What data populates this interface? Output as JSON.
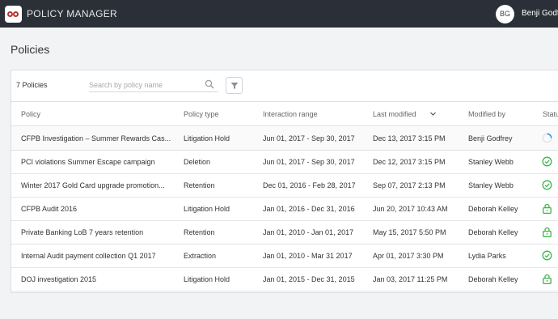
{
  "header": {
    "app_title": "POLICY MANAGER",
    "avatar_initials": "BG",
    "user_name": "Benji Godfrey"
  },
  "page": {
    "title": "Policies"
  },
  "toolbar": {
    "count_label": "7 Policies",
    "search_placeholder": "Search by policy name"
  },
  "table": {
    "columns": {
      "policy": "Policy",
      "policy_type": "Policy type",
      "interaction_range": "Interaction range",
      "last_modified": "Last modified",
      "modified_by": "Modified by",
      "status": "Status"
    },
    "sort": {
      "column": "last_modified",
      "direction": "descending"
    },
    "rows": [
      {
        "policy": "CFPB Investigation – Summer Rewards Cas...",
        "type": "Litigation Hold",
        "range": "Jun 01, 2017 - Sep 30, 2017",
        "last_modified": "Dec 13, 2017 3:15 PM",
        "modified_by": "Benji Godfrey",
        "status_icon": "loading-spinner-icon"
      },
      {
        "policy": "PCI violations Summer Escape campaign",
        "type": "Deletion",
        "range": "Jun 01, 2017 - Sep 30, 2017",
        "last_modified": "Dec 12, 2017 3:15 PM",
        "modified_by": "Stanley Webb",
        "status_icon": "check-circle-icon"
      },
      {
        "policy": "Winter 2017 Gold Card upgrade promotion...",
        "type": "Retention",
        "range": "Dec 01, 2016 - Feb 28, 2017",
        "last_modified": "Sep 07, 2017 2:13 PM",
        "modified_by": "Stanley Webb",
        "status_icon": "check-circle-icon"
      },
      {
        "policy": "CFPB Audit 2016",
        "type": "Litigation Hold",
        "range": "Jan 01, 2016 - Dec 31, 2016",
        "last_modified": "Jun 20, 2017 10:43 AM",
        "modified_by": "Deborah Kelley",
        "status_icon": "lock-icon"
      },
      {
        "policy": "Private Banking LoB 7 years retention",
        "type": "Retention",
        "range": "Jan 01, 2010 - Jan 01, 2017",
        "last_modified": "May 15, 2017 5:50 PM",
        "modified_by": "Deborah Kelley",
        "status_icon": "lock-icon"
      },
      {
        "policy": "Internal Audit payment collection Q1 2017",
        "type": "Extraction",
        "range": "Jan 01, 2010 - Mar 31 2017",
        "last_modified": "Apr 01, 2017 3:30 PM",
        "modified_by": "Lydia Parks",
        "status_icon": "check-circle-icon"
      },
      {
        "policy": "DOJ investigation 2015",
        "type": "Litigation Hold",
        "range": "Jan 01, 2015 - Dec 31, 2015",
        "last_modified": "Jan 03, 2017 11:25 PM",
        "modified_by": "Deborah Kelley",
        "status_icon": "lock-icon"
      }
    ]
  },
  "colors": {
    "topbar": "#2b3038",
    "logo_accent": "#b8322d",
    "status_green": "#3cb44b",
    "spinner_blue": "#1e88e5"
  }
}
